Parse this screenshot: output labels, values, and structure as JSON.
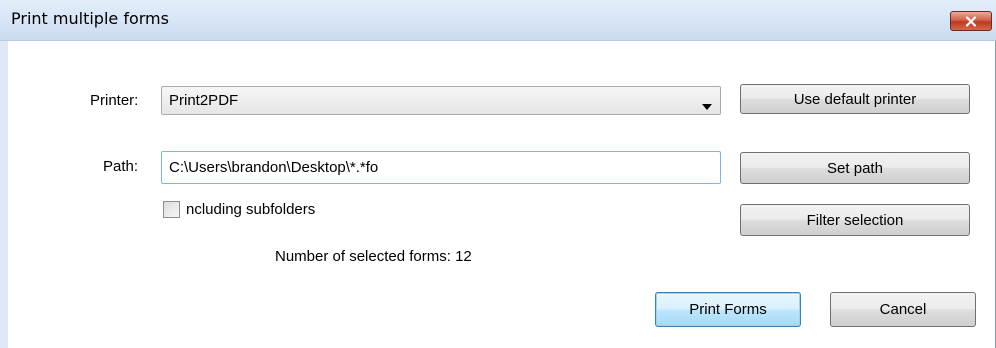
{
  "window": {
    "title": "Print multiple forms"
  },
  "form": {
    "printer_label": "Printer:",
    "printer_value": "Print2PDF",
    "path_label": "Path:",
    "path_value": "C:\\Users\\brandon\\Desktop\\*.*fo",
    "subfolders_label": "ncluding subfolders",
    "subfolders_checked": false,
    "selected_count_text": "Number of selected forms: 12"
  },
  "buttons": {
    "use_default_printer": "Use default printer",
    "set_path": "Set path",
    "filter_selection": "Filter selection",
    "print_forms": "Print Forms",
    "cancel": "Cancel"
  },
  "icons": {
    "close": "close-icon",
    "dropdown": "chevron-down-icon"
  },
  "colors": {
    "titlebar": "#d6e4f5",
    "close_button": "#c0391f",
    "default_button": "#bee6fd",
    "input_focus_border": "#7eb4ea"
  }
}
